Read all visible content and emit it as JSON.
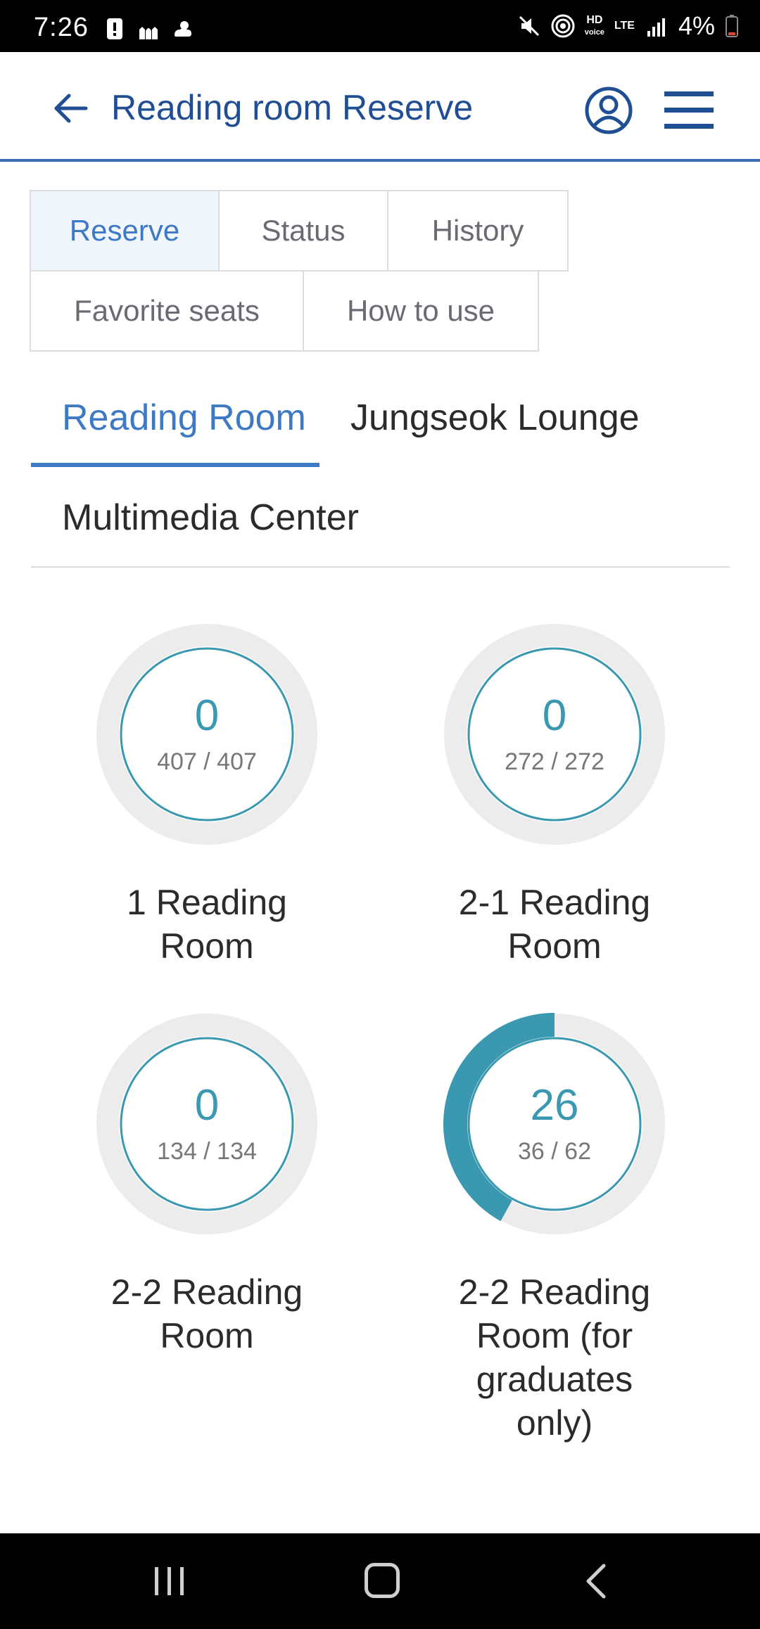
{
  "status_bar": {
    "time": "7:26",
    "hd_label": "HD",
    "voice_label": "voice",
    "lte_label": "LTE",
    "battery": "4%"
  },
  "header": {
    "title": "Reading room Reserve"
  },
  "top_tabs": [
    {
      "label": "Reserve",
      "active": true
    },
    {
      "label": "Status",
      "active": false
    },
    {
      "label": "History",
      "active": false
    },
    {
      "label": "Favorite seats",
      "active": false
    },
    {
      "label": "How to use",
      "active": false
    }
  ],
  "sub_tabs": [
    {
      "label": "Reading Room",
      "active": true
    },
    {
      "label": "Jungseok Lounge",
      "active": false
    },
    {
      "label": "Multimedia Center",
      "active": false
    }
  ],
  "rooms": [
    {
      "available": "0",
      "ratio": "407 / 407",
      "name_line1": "1 Reading",
      "name_line2": "Room",
      "name_line3": "",
      "name_line4": "",
      "used_fraction": 0
    },
    {
      "available": "0",
      "ratio": "272 / 272",
      "name_line1": "2-1 Reading",
      "name_line2": "Room",
      "name_line3": "",
      "name_line4": "",
      "used_fraction": 0
    },
    {
      "available": "0",
      "ratio": "134 / 134",
      "name_line1": "2-2 Reading",
      "name_line2": "Room",
      "name_line3": "",
      "name_line4": "",
      "used_fraction": 0
    },
    {
      "available": "26",
      "ratio": "36 / 62",
      "name_line1": "2-2 Reading",
      "name_line2": "Room (for",
      "name_line3": "graduates",
      "name_line4": "only)",
      "used_fraction": 0.4194
    }
  ],
  "colors": {
    "accent": "#3d79c4",
    "title_blue": "#1f4e94",
    "gauge_teal": "#3a98b0",
    "gauge_track": "#ececec"
  }
}
